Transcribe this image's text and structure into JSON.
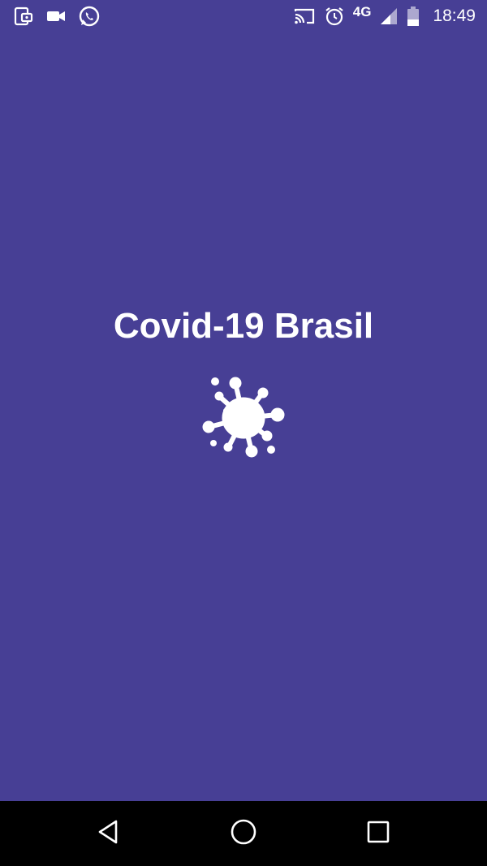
{
  "status_bar": {
    "left_icons": [
      "screen-share-icon",
      "video-camera-icon",
      "whatsapp-icon"
    ],
    "right_icons": [
      "cast-icon",
      "alarm-icon",
      "signal-icon",
      "battery-icon"
    ],
    "network": "4G",
    "time": "18:49"
  },
  "splash": {
    "title": "Covid-19 Brasil",
    "logo_icon": "virus-icon"
  },
  "nav_bar": {
    "buttons": [
      "back-icon",
      "home-icon",
      "recents-icon"
    ]
  },
  "colors": {
    "background": "#473F95",
    "foreground": "#FFFFFF",
    "nav_bar": "#000000"
  }
}
